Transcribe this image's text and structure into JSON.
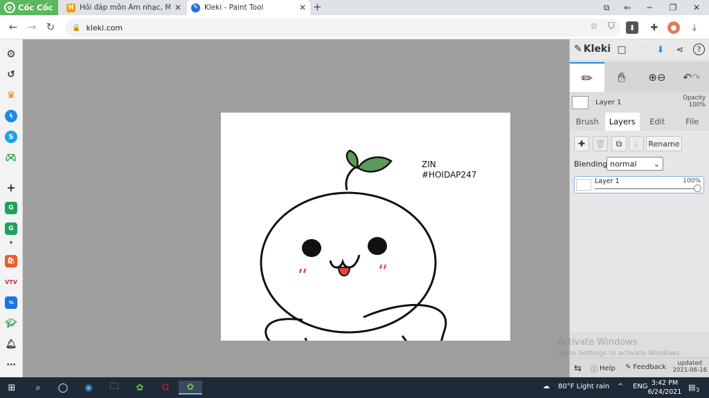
{
  "browser": {
    "brand": "Cốc Cốc",
    "tabs": [
      {
        "label": "Hỏi đáp môn Âm nhạc, Mỹ th",
        "icon": "hoidap-favicon"
      },
      {
        "label": "Kleki - Paint Tool",
        "icon": "kleki-favicon"
      }
    ],
    "url": "kleki.com"
  },
  "canvas": {
    "note_line1": "ZIN",
    "note_line2": "#HOIDAP247"
  },
  "panel": {
    "logo": "Kleki",
    "layer_name": "Layer 1",
    "opacity_label": "Opacity",
    "opacity_value": "100%",
    "tabs": [
      "Brush",
      "Layers",
      "Edit",
      "File"
    ],
    "active_tab": "Layers",
    "rename_label": "Rename",
    "blending_label": "Blending",
    "blending_value": "normal",
    "layer_item": {
      "name": "Layer 1",
      "opacity": "100%"
    },
    "help_label": "Help",
    "feedback_label": "Feedback",
    "updated_label": "updated",
    "updated_date": "2021-06-16"
  },
  "watermark": {
    "title": "Activate Windows",
    "subtitle": "Go to Settings to activate Windows."
  },
  "taskbar": {
    "weather": "80°F  Light rain",
    "language": "ENG",
    "time": "3:42 PM",
    "date": "6/24/2021",
    "notifications": "3"
  },
  "colors": {
    "brand_green": "#5cb85c",
    "active_blue": "#1e88e5",
    "leaf_green": "#5a9a5a",
    "tongue_red": "#e8433a",
    "taskbar": "#1f2a38"
  }
}
